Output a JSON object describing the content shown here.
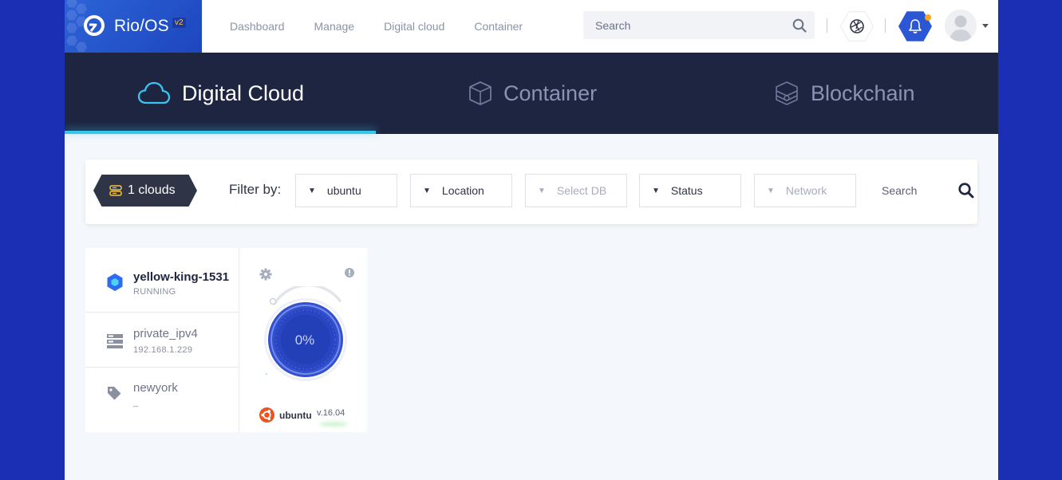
{
  "brand": {
    "name": "Rio/OS",
    "version": "v2"
  },
  "nav": [
    "Dashboard",
    "Manage",
    "Digital cloud",
    "Container"
  ],
  "search": {
    "placeholder": "Search"
  },
  "tabs": [
    {
      "label": "Digital Cloud",
      "icon": "cloud-icon",
      "active": true
    },
    {
      "label": "Container",
      "icon": "cube-icon",
      "active": false
    },
    {
      "label": "Blockchain",
      "icon": "blockchain-icon",
      "active": false
    }
  ],
  "filter": {
    "count_label": "1 clouds",
    "label": "Filter by:",
    "selects": [
      {
        "value": "ubuntu",
        "active": true
      },
      {
        "value": "Location",
        "active": true
      },
      {
        "value": "Select DB",
        "active": false
      },
      {
        "value": "Status",
        "active": true
      },
      {
        "value": "Network",
        "active": false
      }
    ],
    "search_placeholder": "Search"
  },
  "cloud": {
    "name": "yellow-king-1531",
    "status": "RUNNING",
    "network_name": "private_ipv4",
    "ip": "192.168.1.229",
    "location": "newyork",
    "location_sub": "_",
    "usage": "0%",
    "os": "ubuntu",
    "os_version": "v.16.04"
  },
  "colors": {
    "background": "#1a2fb3",
    "brand": "#2d63d8",
    "tabbar": "#1e2541",
    "accent": "#36c6f0",
    "notification": "#f5a623"
  }
}
